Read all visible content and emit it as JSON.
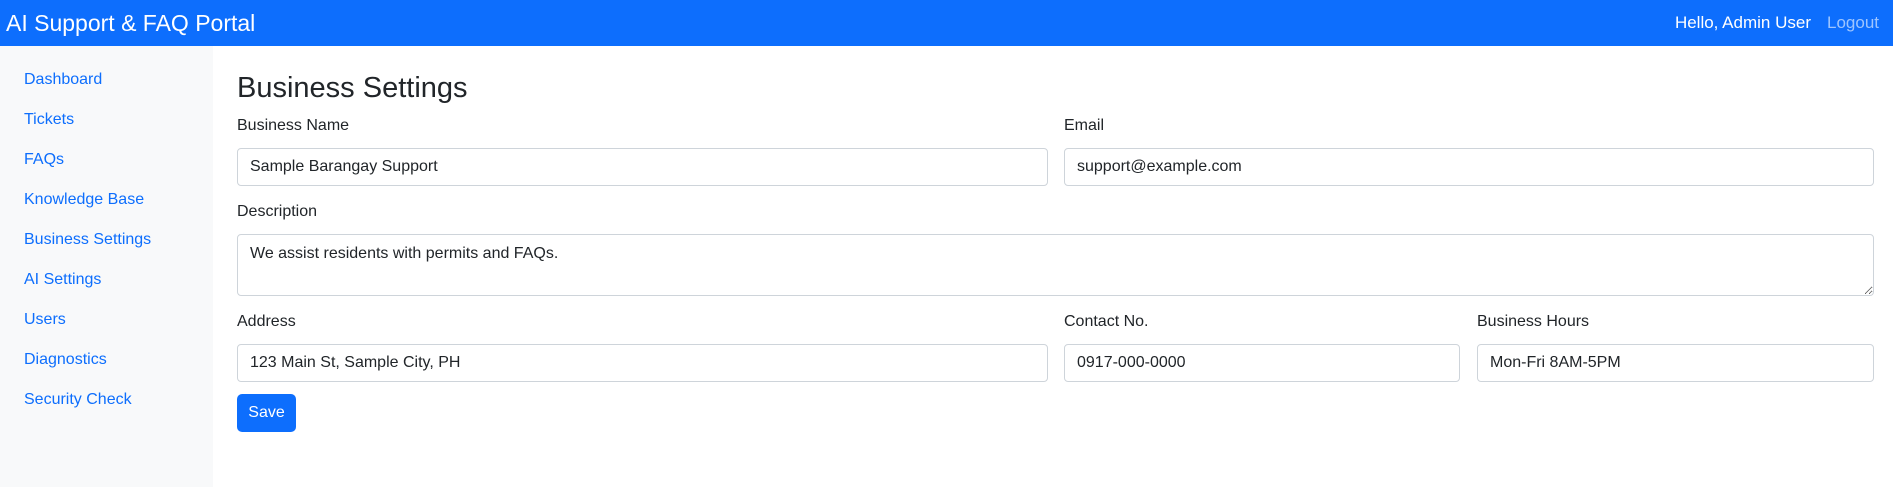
{
  "header": {
    "brand": "AI Support & FAQ Portal",
    "greeting": "Hello, Admin User",
    "logout_label": "Logout"
  },
  "sidebar": {
    "items": [
      {
        "label": "Dashboard"
      },
      {
        "label": "Tickets"
      },
      {
        "label": "FAQs"
      },
      {
        "label": "Knowledge Base"
      },
      {
        "label": "Business Settings"
      },
      {
        "label": "AI Settings"
      },
      {
        "label": "Users"
      },
      {
        "label": "Diagnostics"
      },
      {
        "label": "Security Check"
      }
    ]
  },
  "main": {
    "title": "Business Settings",
    "form": {
      "business_name": {
        "label": "Business Name",
        "value": "Sample Barangay Support"
      },
      "email": {
        "label": "Email",
        "value": "support@example.com"
      },
      "description": {
        "label": "Description",
        "value": "We assist residents with permits and FAQs."
      },
      "address": {
        "label": "Address",
        "value": "123 Main St, Sample City, PH"
      },
      "contact": {
        "label": "Contact No.",
        "value": "0917-000-0000"
      },
      "hours": {
        "label": "Business Hours",
        "value": "Mon-Fri 8AM-5PM"
      },
      "save_label": "Save"
    }
  },
  "colors": {
    "primary": "#0d6efd",
    "sidebar_bg": "#f8f9fa",
    "logout_link": "#9ec5fe"
  }
}
